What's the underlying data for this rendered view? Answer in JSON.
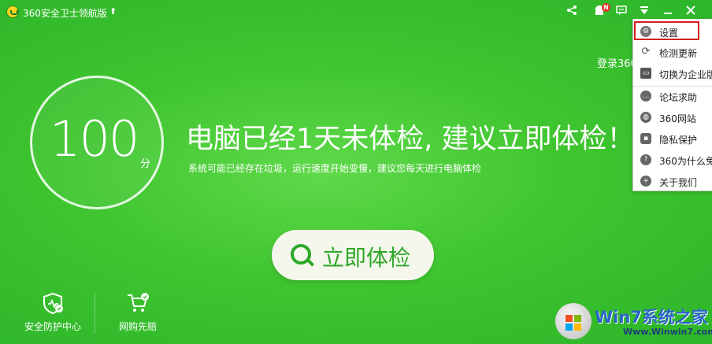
{
  "titlebar": {
    "app_title": "360安全卫士领航版",
    "upgrade_icon": "up-arrow-icon",
    "badge": "N",
    "icons": [
      "share-icon",
      "skin-icon",
      "message-icon",
      "menu-arrow-icon",
      "minimize-icon",
      "close-icon"
    ]
  },
  "score": {
    "value": "100",
    "unit": "分"
  },
  "main": {
    "headline": "电脑已经1天未体检, 建议立即体检！",
    "subline": "系统可能已经存在垃圾，运行速度开始变慢，建议您每天进行电脑体检",
    "check_button": "立即体检",
    "login_hint": "登录360"
  },
  "features": [
    {
      "label": "安全防护中心",
      "icon": "shield-icon"
    },
    {
      "label": "网购先赔",
      "icon": "shopping-cart-icon"
    }
  ],
  "menu": {
    "items": [
      {
        "label": "设置",
        "icon": "gear-icon"
      },
      {
        "label": "检测更新",
        "icon": "refresh-icon"
      },
      {
        "label": "切换为企业版",
        "icon": "monitor-icon"
      },
      {
        "label": "论坛求助",
        "icon": "chat-icon"
      },
      {
        "label": "360网站",
        "icon": "globe-icon"
      },
      {
        "label": "隐私保护",
        "icon": "lock-icon"
      },
      {
        "label": "360为什么免",
        "icon": "question-icon"
      },
      {
        "label": "关于我们",
        "icon": "plus-circle-icon"
      }
    ]
  },
  "watermark": {
    "title": "Win7系统之家",
    "url": "Www.Winwin7.com"
  },
  "colors": {
    "primary_green": "#3fc52f",
    "button_text": "#2fa82a",
    "highlight_red": "#d11f1f",
    "watermark_blue": "#2a64c8"
  }
}
